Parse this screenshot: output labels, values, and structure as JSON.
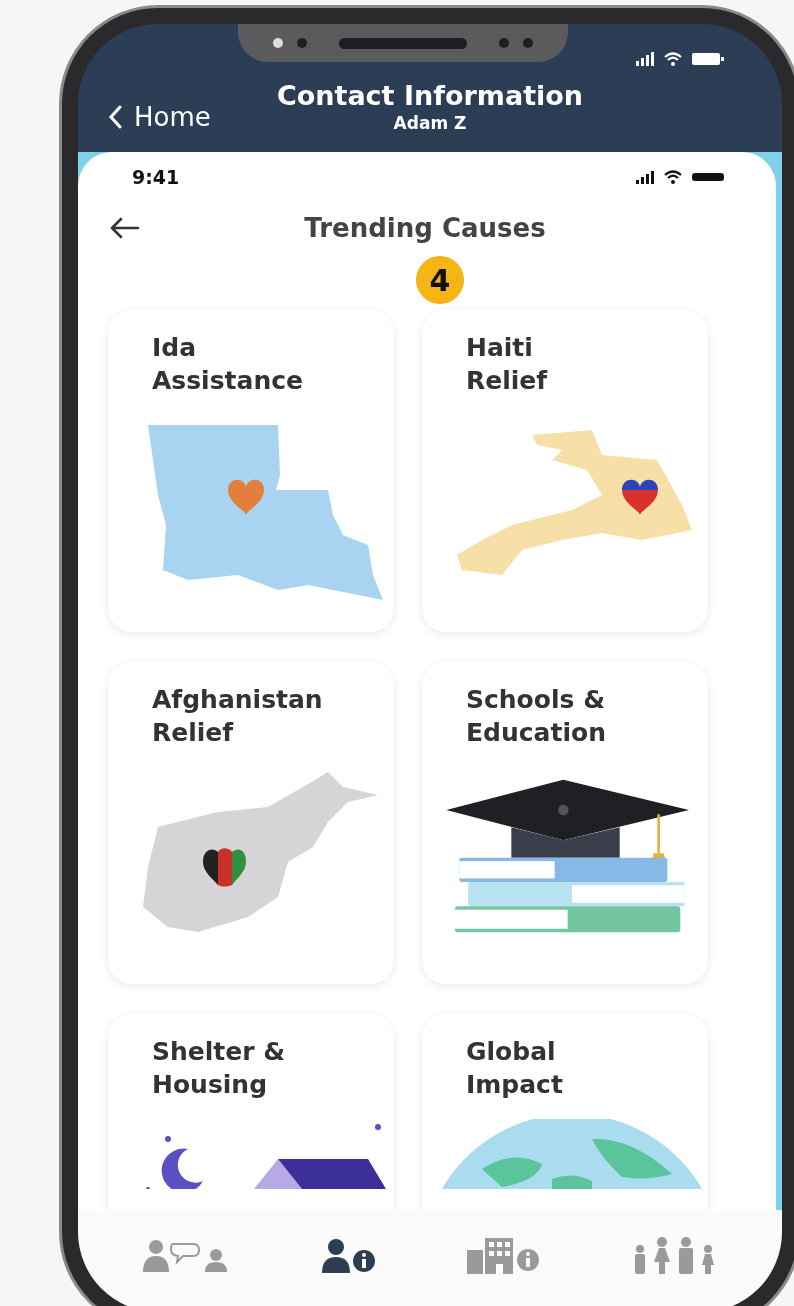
{
  "nav": {
    "back_label": "Home",
    "title": "Contact Information",
    "subtitle": "Adam Z"
  },
  "inner_screen": {
    "time": "9:41",
    "title": "Trending Causes",
    "badge": "4",
    "causes": [
      {
        "title": "Ida\nAssistance",
        "kind": "louisiana"
      },
      {
        "title": "Haiti\nRelief",
        "kind": "haiti"
      },
      {
        "title": "Afghanistan\nRelief",
        "kind": "afghanistan"
      },
      {
        "title": "Schools &\nEducation",
        "kind": "education"
      },
      {
        "title": "Shelter &\nHousing",
        "kind": "housing"
      },
      {
        "title": "Global\nImpact",
        "kind": "globe"
      }
    ]
  },
  "tab_bar": {
    "tabs": [
      {
        "kind": "contacts-chat",
        "selected": false
      },
      {
        "kind": "contact-info",
        "selected": true
      },
      {
        "kind": "building-info",
        "selected": false
      },
      {
        "kind": "family",
        "selected": false
      }
    ]
  }
}
